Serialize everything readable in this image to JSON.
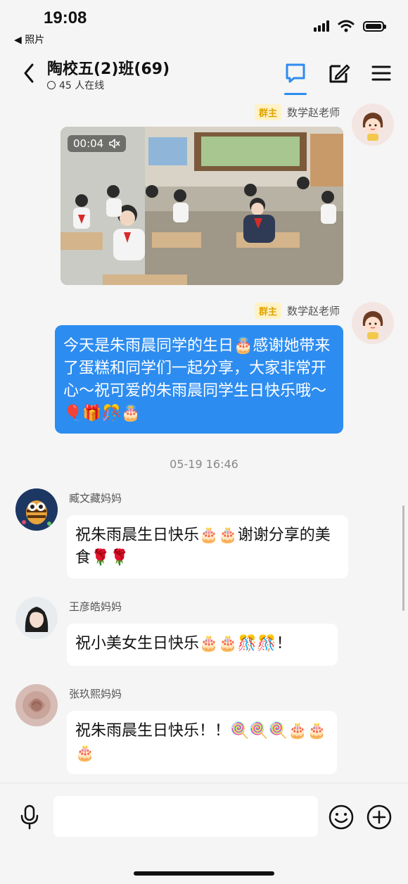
{
  "status": {
    "time": "19:08",
    "back_app": "照片"
  },
  "header": {
    "title": "陶校五(2)班(69)",
    "online": "45 人在线"
  },
  "messages": [
    {
      "sender": "数学赵老师",
      "badge": "群主",
      "type": "video",
      "duration": "00:04"
    },
    {
      "sender": "数学赵老师",
      "badge": "群主",
      "type": "text",
      "text": "今天是朱雨晨同学的生日🎂感谢她带来了蛋糕和同学们一起分享，大家非常开心～祝可爱的朱雨晨同学生日快乐哦～🎈🎁🎊🎂"
    },
    {
      "timestamp": "05-19 16:46"
    },
    {
      "sender": "臧文藏妈妈",
      "type": "text",
      "text": "祝朱雨晨生日快乐🎂🎂谢谢分享的美食🌹🌹"
    },
    {
      "sender": "王彦皓妈妈",
      "type": "text",
      "text": "祝小美女生日快乐🎂🎂🎊🎊！"
    },
    {
      "sender": "张玖熙妈妈",
      "type": "text",
      "text": "祝朱雨晨生日快乐！！🍭🍭🍭🎂🎂🎂"
    }
  ],
  "colors": {
    "accent": "#2d8cf0",
    "badge_bg": "#fff2c6",
    "badge_text": "#e0a400",
    "background": "#f5f5f5"
  }
}
